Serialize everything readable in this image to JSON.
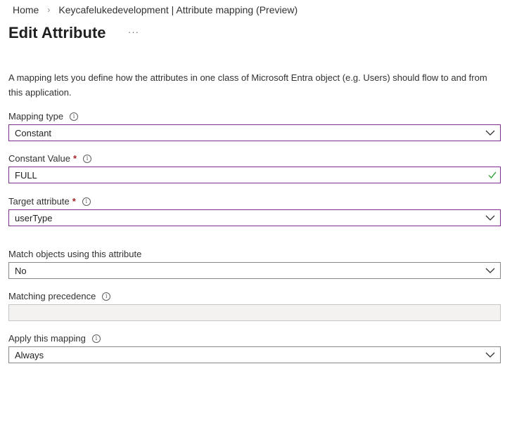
{
  "breadcrumb": {
    "home": "Home",
    "current": "Keycafelukedevelopment | Attribute mapping (Preview)"
  },
  "title": "Edit Attribute",
  "more_label": "···",
  "description": "A mapping lets you define how the attributes in one class of Microsoft Entra object (e.g. Users) should flow to and from this application.",
  "mapping_type": {
    "label": "Mapping type",
    "value": "Constant"
  },
  "constant_value": {
    "label": "Constant Value",
    "required": "*",
    "value": "FULL"
  },
  "target_attribute": {
    "label": "Target attribute",
    "required": "*",
    "value": "userType"
  },
  "match_objects": {
    "label": "Match objects using this attribute",
    "value": "No"
  },
  "matching_precedence": {
    "label": "Matching precedence",
    "value": ""
  },
  "apply_mapping": {
    "label": "Apply this mapping",
    "value": "Always"
  },
  "icons": {
    "info": "info-icon",
    "dropdown": "chevron-down-icon",
    "valid": "checkmark-icon"
  },
  "colors": {
    "focus_border": "#7b2f8a",
    "required": "#a4262c",
    "valid": "#3aa339"
  }
}
